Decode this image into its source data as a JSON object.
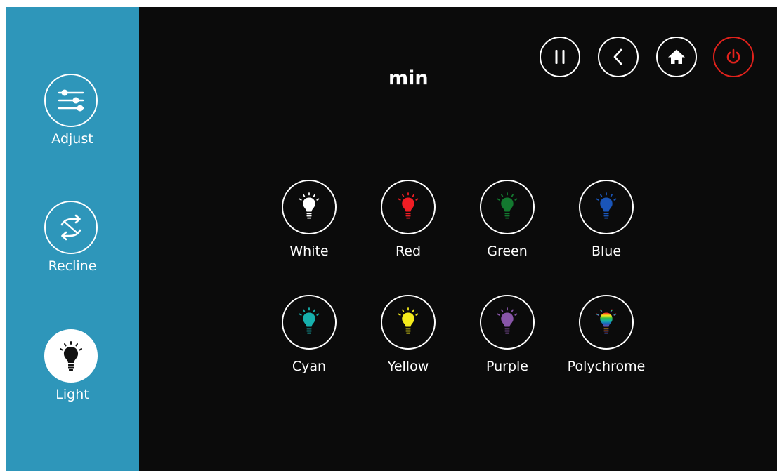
{
  "title": "min",
  "sidebar": {
    "items": [
      {
        "label": "Adjust",
        "icon": "sliders-icon",
        "active": false
      },
      {
        "label": "Recline",
        "icon": "swap-arrows-icon",
        "active": false
      },
      {
        "label": "Light",
        "icon": "bulb-icon",
        "active": true
      }
    ]
  },
  "top_controls": [
    {
      "icon": "pause-icon"
    },
    {
      "icon": "back-icon"
    },
    {
      "icon": "home-icon"
    },
    {
      "icon": "power-icon",
      "color": "#e1221c"
    }
  ],
  "lights": [
    {
      "label": "White",
      "color": "#ffffff"
    },
    {
      "label": "Red",
      "color": "#ef1d24"
    },
    {
      "label": "Green",
      "color": "#13782f"
    },
    {
      "label": "Blue",
      "color": "#1a55b8"
    },
    {
      "label": "Cyan",
      "color": "#16b0ad"
    },
    {
      "label": "Yellow",
      "color": "#f4ea1b"
    },
    {
      "label": "Purple",
      "color": "#8855a8"
    },
    {
      "label": "Polychrome",
      "color": "rainbow"
    }
  ],
  "colors": {
    "sidebar_bg": "#2e96ba",
    "panel_bg": "#0b0b0b",
    "power_red": "#e1221c"
  }
}
